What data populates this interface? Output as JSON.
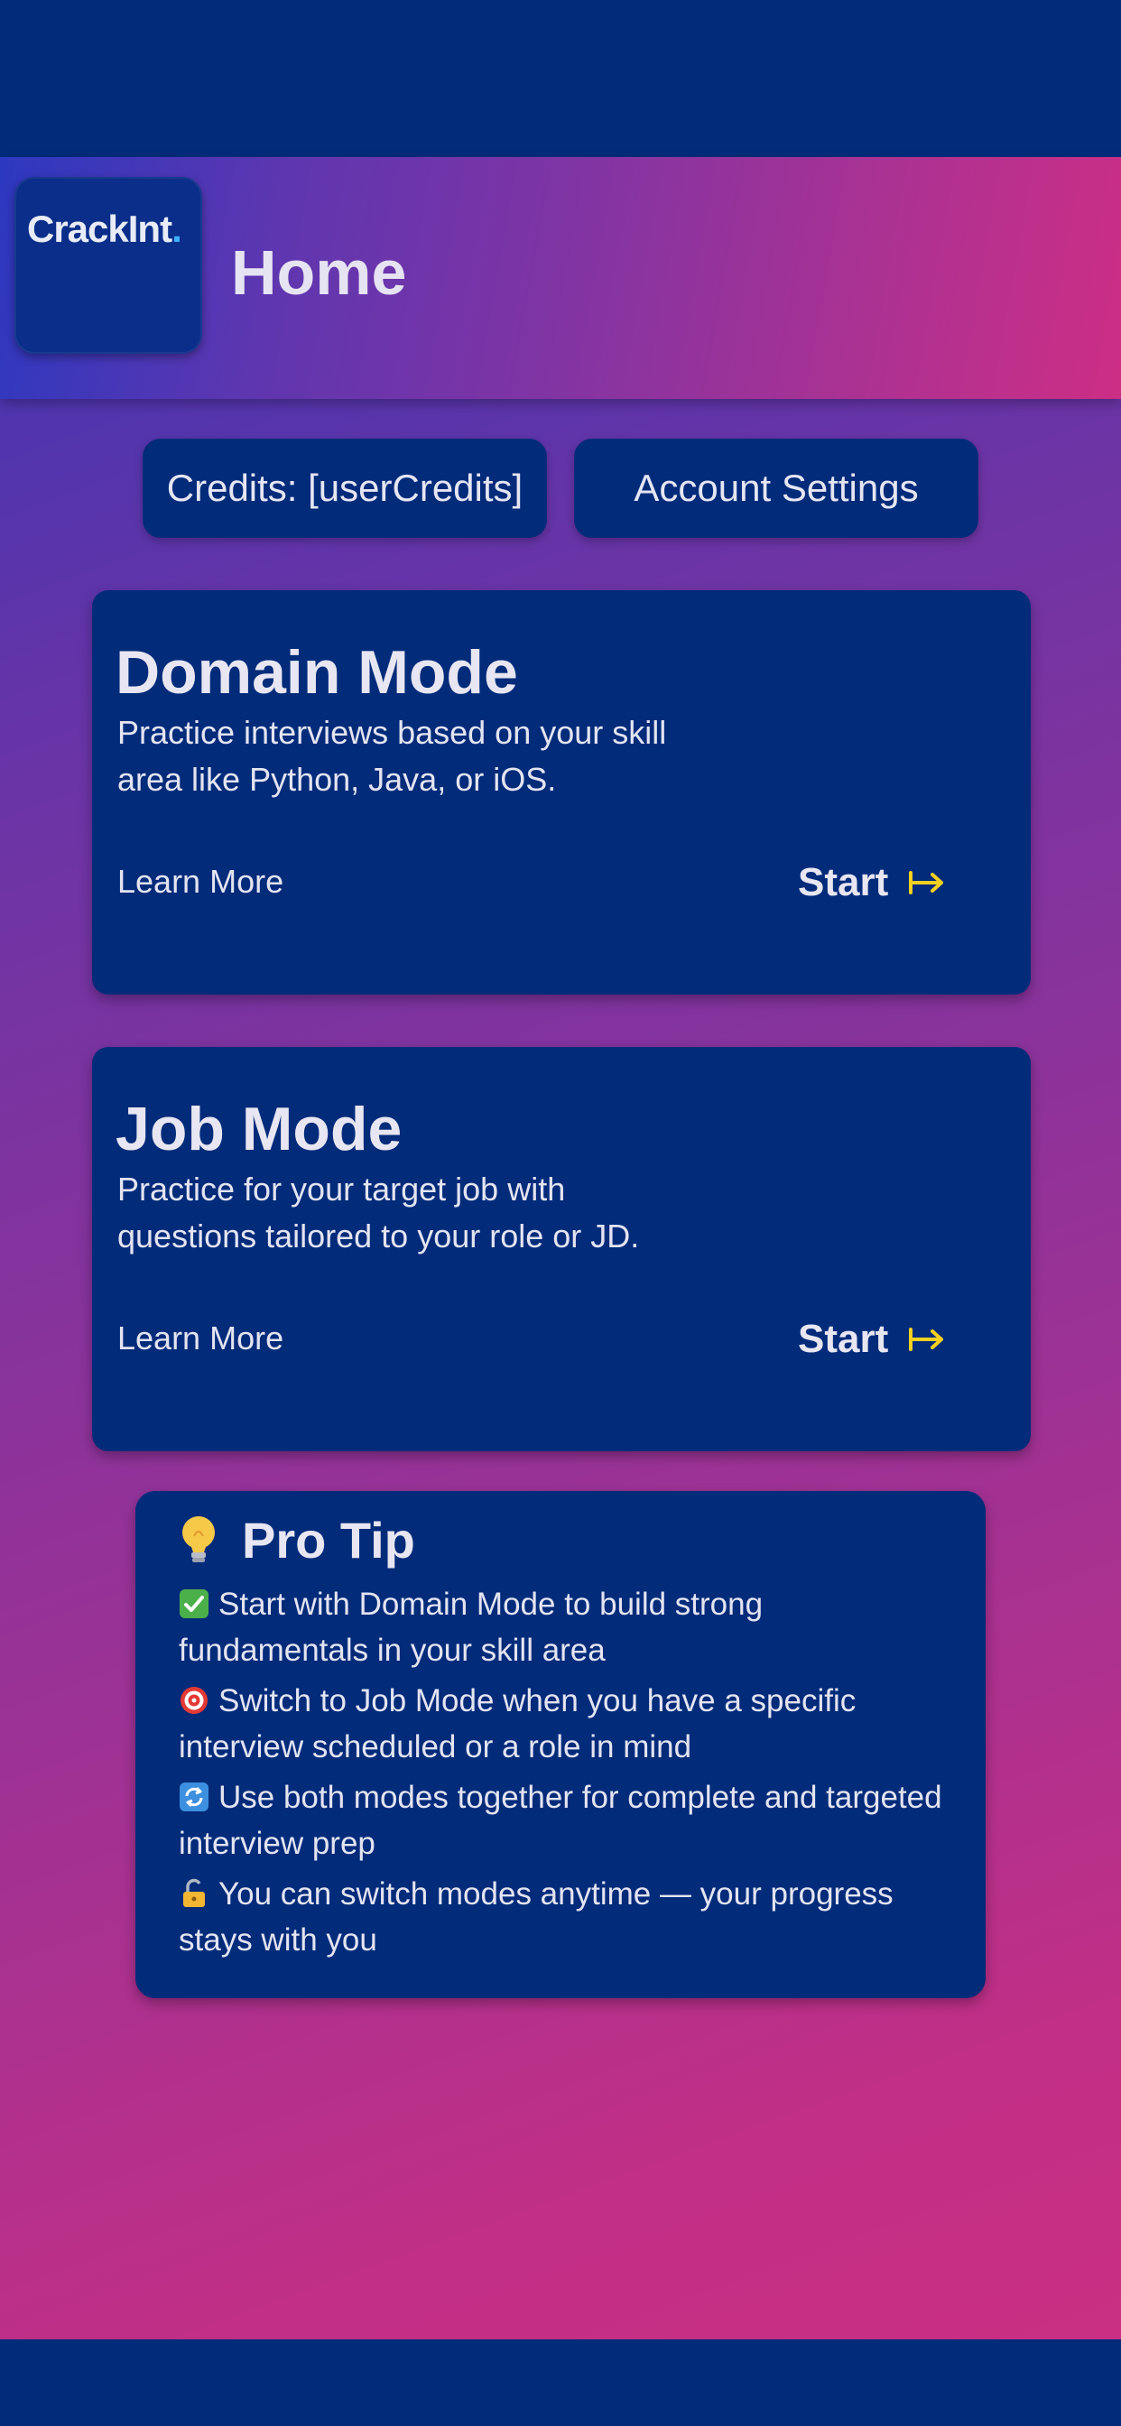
{
  "header": {
    "logo_text": "CrackInt",
    "logo_dot": ".",
    "title": "Home"
  },
  "actions": {
    "credits_label": "Credits: [userCredits]",
    "settings_label": "Account Settings"
  },
  "modes": [
    {
      "title": "Domain Mode",
      "description": "Practice interviews based on your skill area like Python, Java, or iOS.",
      "learn_more": "Learn More",
      "start": "Start"
    },
    {
      "title": "Job Mode",
      "description": "Practice for your target job with questions tailored to your role or JD.",
      "learn_more": "Learn More",
      "start": "Start"
    }
  ],
  "pro_tip": {
    "title": "Pro Tip",
    "items": [
      {
        "icon": "check-mark-icon",
        "text": "Start with Domain Mode to build strong fundamentals in your skill area"
      },
      {
        "icon": "target-icon",
        "text": "Switch to Job Mode when you have a specific interview scheduled or a role in mind"
      },
      {
        "icon": "repeat-icon",
        "text": "Use both modes together for complete and targeted interview prep"
      },
      {
        "icon": "unlock-icon",
        "text": "You can switch modes anytime — your progress stays with you"
      }
    ]
  },
  "colors": {
    "navy": "#022b7a",
    "accent_arrow": "#f5d020",
    "gradient_start": "#3236b8",
    "gradient_end": "#cc2f82"
  }
}
